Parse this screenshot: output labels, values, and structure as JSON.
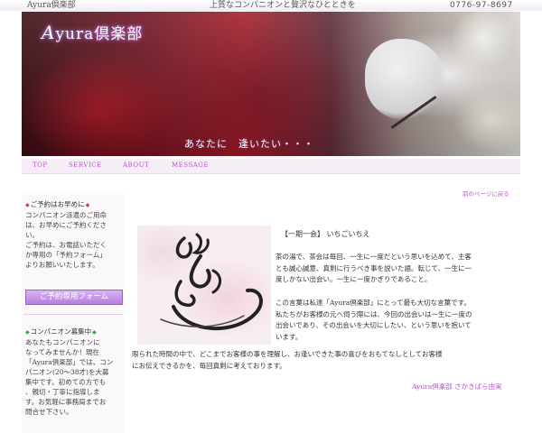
{
  "topbar": {
    "site_name": "Ayura倶楽部",
    "tagline": "上質なコンパニオンと贅沢なひとときを",
    "phone": "0776-97-8697"
  },
  "hero": {
    "logo_first": "A",
    "logo_rest": "yura倶楽部",
    "catchphrase": "あなたに　逢いたい・・・"
  },
  "nav": {
    "items": [
      "TOP",
      "SERVICE",
      "ABOUT",
      "MESSAGE"
    ]
  },
  "sidebar": {
    "reserve_heading": "ご予約はお早めに",
    "reserve_lines": [
      "コンパニオン派遣のご用命",
      "は、お早めにご予約くださ",
      "い。",
      "ご予約は、お電話いただく",
      "か専用の「予約フォーム」",
      "よりお願いいたします。"
    ],
    "reserve_button": "ご予約専用フォーム",
    "recruit_heading": "コンパニオン募集中",
    "recruit_lines": [
      "あなたもコンパニオンに",
      "なってみませんか！現在",
      "「Ayura倶楽部」では、コン",
      "パニオン(20〜38才)を大募",
      "集中です。初めての方でも",
      "、親切・丁寧に指導しま",
      "す。お気軽に事務局までお",
      "問合せ下さい。"
    ]
  },
  "main": {
    "back_link": "前のページに戻る",
    "title": "【一期一会】 いちごいちえ",
    "para1": [
      "茶の湯で、茶会は毎回、一生に一度だという思いを込めて、主客",
      "とも誠心誠意、真剣に行うべき事を説いた語。転じて、一生に一",
      "度しかない出会い。一生に一度かぎりであること。"
    ],
    "para2": [
      "この言葉は私達「Ayura倶楽部」にとって最も大切な言葉です。",
      "私たちがお客様の元へ伺う際には、今回の出会いは一生に一度の",
      "出会いであり、その出会いを大切にしたい、という思いを抱いて",
      "います。"
    ],
    "para3": [
      "限られた時間の中で、どこまでお客様の事を理解し、お逢いできた事の喜びをおもてなしとしてお客様",
      "にお伝えできるかを、毎回真剣に考えております。"
    ],
    "signature": "Ayura倶楽部 さかきばら由実"
  },
  "colors": {
    "accent": "#bb55cc",
    "button": "#b67ee0",
    "nav_bg": "#f5eef7"
  }
}
